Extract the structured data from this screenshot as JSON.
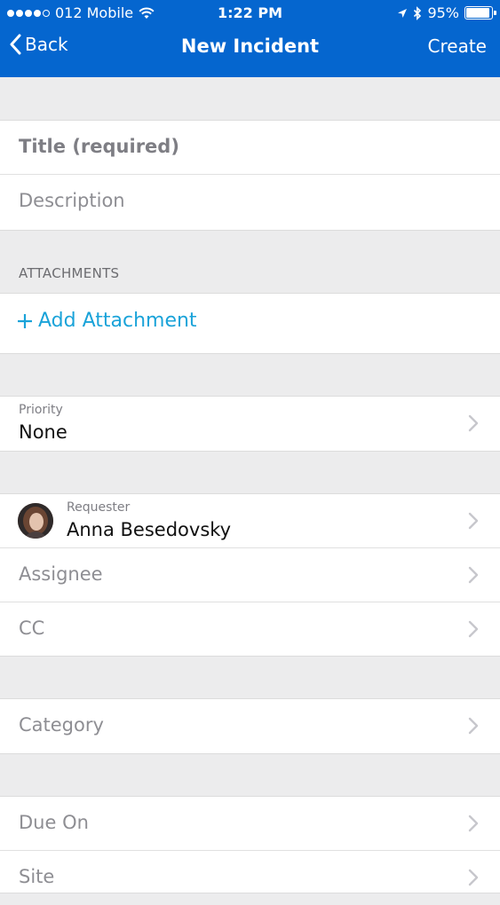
{
  "status": {
    "carrier": "012 Mobile",
    "time": "1:22 PM",
    "battery": "95%"
  },
  "nav": {
    "back_label": "Back",
    "title": "New Incident",
    "create_label": "Create"
  },
  "form": {
    "title_placeholder": "Title (required)",
    "description_placeholder": "Description",
    "attachments_header": "ATTACHMENTS",
    "add_attachment_label": "Add Attachment",
    "priority_label": "Priority",
    "priority_value": "None",
    "requester_label": "Requester",
    "requester_value": "Anna Besedovsky",
    "assignee_label": "Assignee",
    "cc_label": "CC",
    "category_label": "Category",
    "due_on_label": "Due On",
    "site_label": "Site"
  },
  "colors": {
    "nav_bg": "#0566cf",
    "accent": "#1aa3d9"
  }
}
